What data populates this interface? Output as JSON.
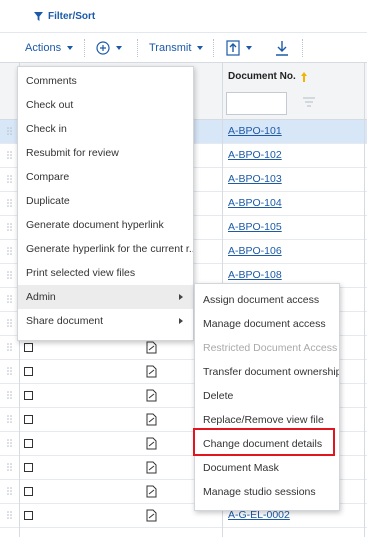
{
  "filter_sort": "Filter/Sort",
  "toolbar": {
    "actions": "Actions",
    "transmit": "Transmit"
  },
  "grid": {
    "column_document_no": "Document No.",
    "rows": [
      {
        "doc": "A-BPO-101",
        "selected": true
      },
      {
        "doc": "A-BPO-102"
      },
      {
        "doc": "A-BPO-103"
      },
      {
        "doc": "A-BPO-104"
      },
      {
        "doc": "A-BPO-105"
      },
      {
        "doc": "A-BPO-106"
      },
      {
        "doc": "A-BPO-108"
      },
      {
        "doc": ""
      },
      {
        "doc": ""
      },
      {
        "doc": ""
      },
      {
        "doc": ""
      },
      {
        "doc": ""
      },
      {
        "doc": ""
      },
      {
        "doc": ""
      },
      {
        "doc": ""
      },
      {
        "doc": ""
      },
      {
        "doc": "A-G-EL-0002"
      }
    ]
  },
  "actions_menu": [
    {
      "label": "Comments"
    },
    {
      "label": "Check out"
    },
    {
      "label": "Check in"
    },
    {
      "label": "Resubmit for review"
    },
    {
      "label": "Compare"
    },
    {
      "label": "Duplicate"
    },
    {
      "label": "Generate document hyperlink"
    },
    {
      "label": "Generate hyperlink for the current r..."
    },
    {
      "label": "Print selected view files"
    },
    {
      "label": "Admin",
      "submenu": true,
      "hover": true
    },
    {
      "label": "Share document",
      "submenu": true
    }
  ],
  "admin_menu": [
    {
      "label": "Assign document access"
    },
    {
      "label": "Manage document access"
    },
    {
      "label": "Restricted Document Access",
      "disabled": true
    },
    {
      "label": "Transfer document ownership"
    },
    {
      "label": "Delete"
    },
    {
      "label": "Replace/Remove view file"
    },
    {
      "label": "Change document details",
      "highlighted": true
    },
    {
      "label": "Document Mask"
    },
    {
      "label": "Manage studio sessions"
    }
  ],
  "colors": {
    "link": "#1b5aa8",
    "selected_row": "#d8e7f8",
    "highlight_box": "#e0151d",
    "sort_icon": "#f2b400"
  },
  "icons": [
    "funnel-icon",
    "plus-circle-icon",
    "upload-icon",
    "download-icon",
    "sort-asc-icon",
    "row-grip-icon",
    "document-icon"
  ]
}
